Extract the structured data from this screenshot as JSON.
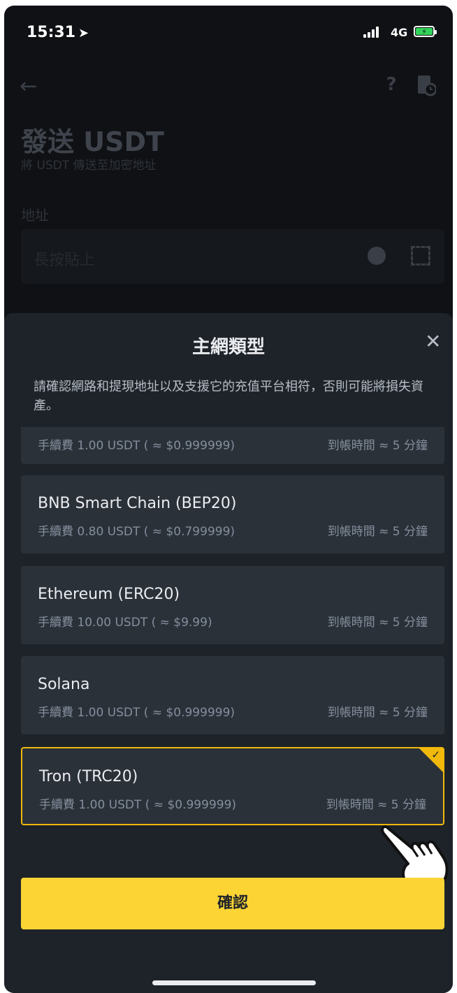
{
  "status_bar": {
    "time": "15:31",
    "location_arrow": "➤",
    "network": "4G",
    "battery_icon": "battery-charging-icon"
  },
  "header": {
    "back_icon": "←",
    "help_icon": "?",
    "history_icon": "history-icon"
  },
  "page": {
    "title": "發送 USDT",
    "subtitle": "將 USDT 傳送至加密地址",
    "address_label": "地址",
    "address_placeholder": "長按貼上"
  },
  "sheet": {
    "title": "主網類型",
    "close_icon": "✕",
    "warning": "請確認網路和提現地址以及支援它的充值平台相符，否則可能將損失資產。",
    "options": [
      {
        "name": "",
        "fee": "手續費 1.00 USDT ( ≈ $0.999999)",
        "eta": "到帳時間 ≈ 5 分鐘"
      },
      {
        "name": "BNB Smart Chain (BEP20)",
        "fee": "手續費 0.80 USDT ( ≈ $0.799999)",
        "eta": "到帳時間 ≈ 5 分鐘"
      },
      {
        "name": "Ethereum (ERC20)",
        "fee": "手續費 10.00 USDT ( ≈ $9.99)",
        "eta": "到帳時間 ≈ 5 分鐘"
      },
      {
        "name": "Solana",
        "fee": "手續費 1.00 USDT ( ≈ $0.999999)",
        "eta": "到帳時間 ≈ 5 分鐘"
      },
      {
        "name": "Tron (TRC20)",
        "fee": "手續費 1.00 USDT ( ≈ $0.999999)",
        "eta": "到帳時間 ≈ 5 分鐘",
        "selected": true
      }
    ],
    "check_mark": "✓",
    "confirm_label": "確認"
  },
  "colors": {
    "accent": "#fcd535",
    "selected_border": "#f0b90b",
    "sheet_bg": "#1e2329",
    "card_bg": "#2b3139"
  }
}
